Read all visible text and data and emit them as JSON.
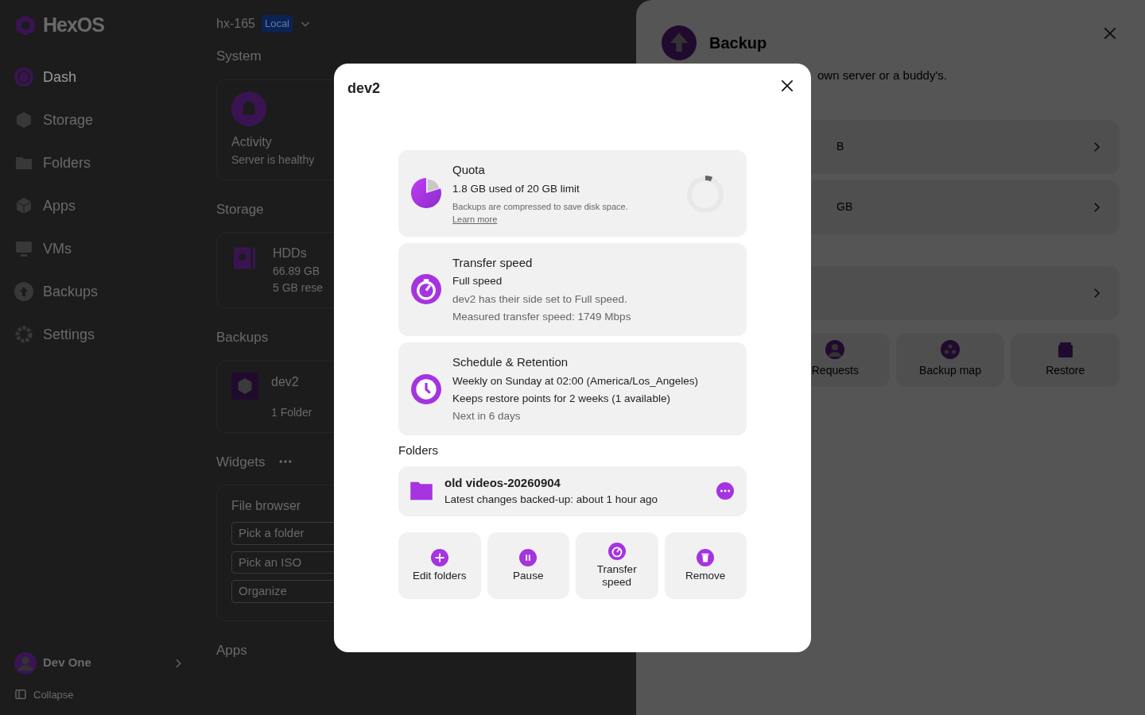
{
  "app": {
    "logo": "HexOS",
    "server": {
      "name": "hx-165",
      "badge": "Local"
    }
  },
  "sidebar": {
    "items": [
      {
        "label": "Dash",
        "selected": true
      },
      {
        "label": "Storage",
        "selected": false
      },
      {
        "label": "Folders",
        "selected": false
      },
      {
        "label": "Apps",
        "selected": false
      },
      {
        "label": "VMs",
        "selected": false
      },
      {
        "label": "Backups",
        "selected": false
      },
      {
        "label": "Settings",
        "selected": false
      }
    ],
    "user": "Dev One",
    "collapse": "Collapse"
  },
  "main": {
    "system": {
      "heading": "System",
      "title": "Activity",
      "subtitle": "Server is healthy"
    },
    "storage": {
      "heading": "Storage",
      "title": "HDDs",
      "lines": [
        "66.89 GB",
        "5 GB rese"
      ]
    },
    "backups": {
      "heading": "Backups",
      "title": "dev2",
      "subtitle": "1 Folder"
    },
    "widgets": {
      "heading": "Widgets",
      "title": "File browser",
      "buttons": [
        "Pick a folder",
        "Pick an ISO",
        "Organize"
      ]
    },
    "apps": {
      "heading": "Apps"
    }
  },
  "drawer": {
    "title": "Backup",
    "subtitle": "own server or a buddy's.",
    "rows": [
      "B",
      "GB",
      ""
    ],
    "tiles": [
      "Requests",
      "Backup map",
      "Restore"
    ]
  },
  "dialog": {
    "title": "dev2",
    "cards": [
      {
        "kind": "quota",
        "title": "Quota",
        "lines": [
          "1.8 GB used of 20 GB limit"
        ],
        "note": "Backups are compressed to save disk space.",
        "link": "Learn more"
      },
      {
        "kind": "speed",
        "title": "Transfer speed",
        "lines": [
          "Full speed"
        ],
        "muted": [
          "dev2 has their side set to Full speed.",
          "Measured transfer speed: 1749 Mbps"
        ]
      },
      {
        "kind": "schedule",
        "title": "Schedule & Retention",
        "lines": [
          "Weekly on Sunday at 02:00 (America/Los_Angeles)",
          "Keeps restore points for 2 weeks (1 available)"
        ],
        "muted": [
          "Next in 6 days"
        ]
      }
    ],
    "folders_heading": "Folders",
    "folders": [
      {
        "name": "old videos-20260904",
        "status": "Latest changes backed-up: about 1 hour ago"
      }
    ],
    "actions": [
      {
        "kind": "add",
        "label": "Edit folders"
      },
      {
        "kind": "pause",
        "label": "Pause"
      },
      {
        "kind": "speed",
        "label": "Transfer speed"
      },
      {
        "kind": "remove",
        "label": "Remove"
      }
    ]
  }
}
